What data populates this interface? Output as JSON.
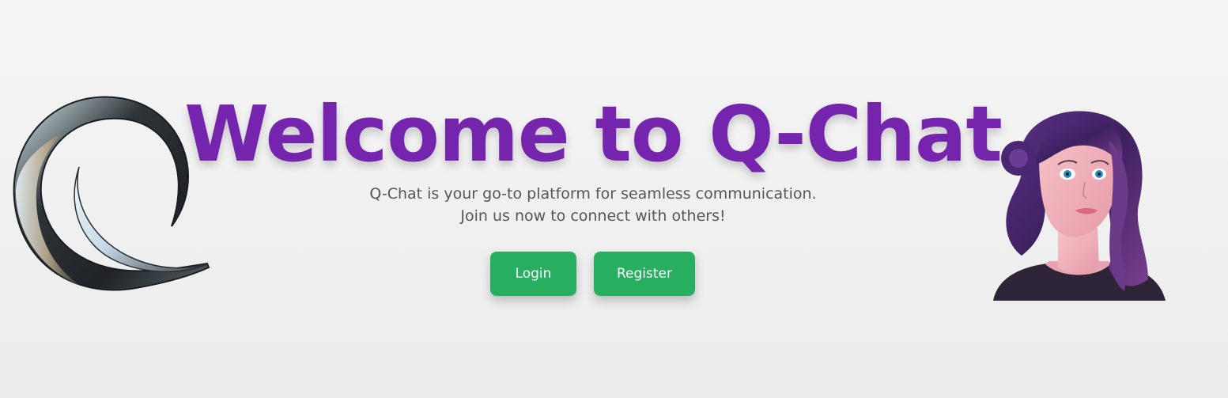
{
  "hero": {
    "title": "Welcome to Q-Chat",
    "subtitle_line1": "Q-Chat is your go-to platform for seamless communication.",
    "subtitle_line2": "Join us now to connect with others!"
  },
  "actions": {
    "login_label": "Login",
    "register_label": "Register"
  },
  "colors": {
    "title": "#7424ad",
    "button": "#28ae60",
    "subtitle": "#555555",
    "background": "#f0f0f0"
  },
  "images": {
    "logo": "q-swirl-logo",
    "avatar": "purple-haired-woman-avatar"
  }
}
